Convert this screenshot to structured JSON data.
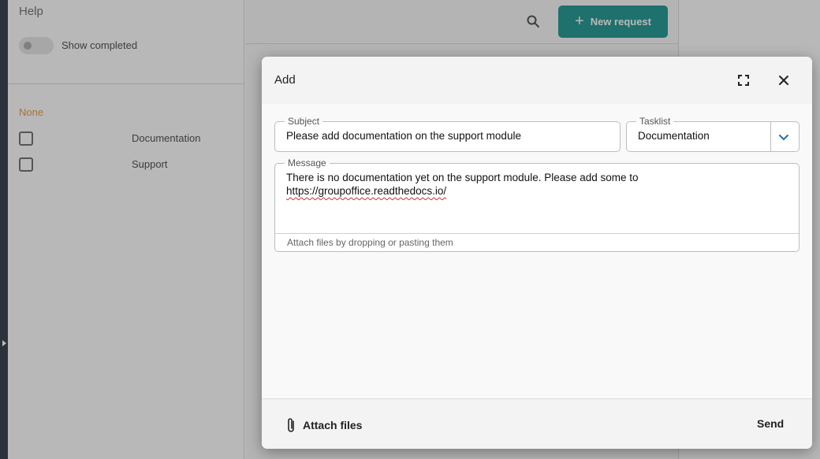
{
  "sidebar": {
    "title": "Help",
    "toggle_label": "Show completed",
    "group_label": "None",
    "items": [
      {
        "label": "Documentation"
      },
      {
        "label": "Support"
      }
    ]
  },
  "main": {
    "new_request_label": "New request",
    "accent_color": "#2a9d97"
  },
  "dialog": {
    "title": "Add",
    "subject": {
      "label": "Subject",
      "value": "Please add documentation on the support module"
    },
    "tasklist": {
      "label": "Tasklist",
      "value": "Documentation"
    },
    "message": {
      "label": "Message",
      "line1": "There is no documentation yet on the support module. Please add some to",
      "link": "https://groupoffice.readthedocs.io/",
      "attach_hint": "Attach files by dropping or pasting them"
    },
    "footer": {
      "attach_files_label": "Attach files",
      "send_label": "Send"
    },
    "icons": [
      "maximize-icon",
      "close-icon",
      "chevron-down-icon",
      "paperclip-icon",
      "search-icon",
      "plus-icon"
    ]
  }
}
